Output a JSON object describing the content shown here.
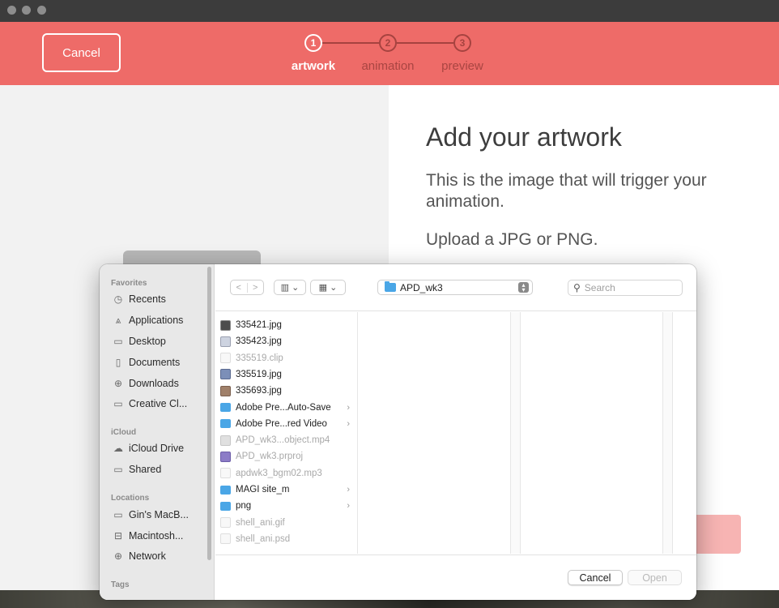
{
  "header": {
    "cancel_label": "Cancel",
    "steps": [
      {
        "number": "1",
        "label": "artwork"
      },
      {
        "number": "2",
        "label": "animation"
      },
      {
        "number": "3",
        "label": "preview"
      }
    ]
  },
  "main": {
    "title": "Add your artwork",
    "description": "This is the image that will trigger your animation.",
    "upload_hint": "Upload a JPG or PNG."
  },
  "dialog": {
    "sidebar": {
      "favorites_label": "Favorites",
      "favorites": [
        "Recents",
        "Applications",
        "Desktop",
        "Documents",
        "Downloads",
        "Creative Cl..."
      ],
      "icloud_label": "iCloud",
      "icloud": [
        "iCloud Drive",
        "Shared"
      ],
      "locations_label": "Locations",
      "locations": [
        "Gin's MacB...",
        "Macintosh...",
        "Network"
      ],
      "tags_label": "Tags"
    },
    "toolbar": {
      "back_icon": "chevron-left-icon",
      "forward_icon": "chevron-right-icon",
      "path": "APD_wk3",
      "search_placeholder": "Search"
    },
    "files": [
      {
        "name": "335421.jpg",
        "icon": "img1",
        "dim": false,
        "folder": false
      },
      {
        "name": "335423.jpg",
        "icon": "img2",
        "dim": false,
        "folder": false
      },
      {
        "name": "335519.clip",
        "icon": "docdim",
        "dim": true,
        "folder": false
      },
      {
        "name": "335519.jpg",
        "icon": "img3",
        "dim": false,
        "folder": false
      },
      {
        "name": "335693.jpg",
        "icon": "img4",
        "dim": false,
        "folder": false
      },
      {
        "name": "Adobe Pre...Auto-Save",
        "icon": "folder",
        "dim": false,
        "folder": true
      },
      {
        "name": "Adobe Pre...red Video",
        "icon": "folder",
        "dim": false,
        "folder": true
      },
      {
        "name": "APD_wk3...object.mp4",
        "icon": "vid",
        "dim": true,
        "folder": false
      },
      {
        "name": "APD_wk3.prproj",
        "icon": "pr",
        "dim": true,
        "folder": false
      },
      {
        "name": "apdwk3_bgm02.mp3",
        "icon": "docdim",
        "dim": true,
        "folder": false
      },
      {
        "name": "MAGI site_m",
        "icon": "folder",
        "dim": false,
        "folder": true
      },
      {
        "name": "png",
        "icon": "folder",
        "dim": false,
        "folder": true
      },
      {
        "name": "shell_ani.gif",
        "icon": "docdim",
        "dim": true,
        "folder": false
      },
      {
        "name": "shell_ani.psd",
        "icon": "docdim",
        "dim": true,
        "folder": false
      }
    ],
    "footer": {
      "cancel_label": "Cancel",
      "open_label": "Open"
    }
  },
  "colors": {
    "accent": "#ee6b68",
    "folder": "#4aa6e6"
  }
}
